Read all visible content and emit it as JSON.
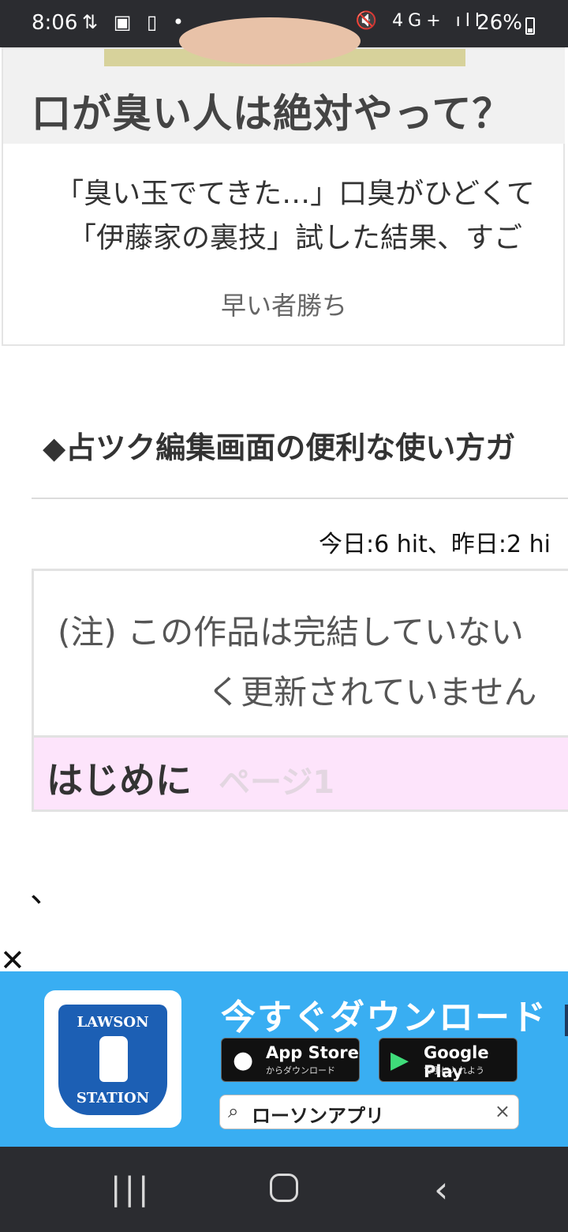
{
  "status_bar": {
    "time": "8:06",
    "left_icons": "⇅ ▣ ▯ •",
    "right_icons": "🔇 4G+ ıll",
    "battery": "26%"
  },
  "ad_card": {
    "headline": "口が臭い人は絶対やって？",
    "body_line1": "「臭い玉でてきた…」口臭がひどくて",
    "body_line2": "「伊藤家の裏技」試した結果、すご",
    "source": "早い者勝ち"
  },
  "article": {
    "title": "◆占ツク編集画面の便利な使い方ガ",
    "hits": "今日:6 hit、昨日:2 hi",
    "notice_line1": "(注) この作品は完結していない",
    "notice_line2": "く更新されていません",
    "section_heading": "はじめに",
    "section_page": "ページ1",
    "body_text": "、"
  },
  "banner": {
    "close": "✕",
    "logo_top": "LAWSON",
    "logo_bottom": "STATION",
    "title": "今すぐダウンロード",
    "app_store_name": "App Store",
    "app_store_sub": "からダウンロード",
    "google_play_name": "Google Play",
    "google_play_sub": "で手に入れよう",
    "search_text": "ローソンアプリ",
    "search_clear": "×",
    "accent_color": "#39aef2"
  },
  "nav_bar": {
    "recents": "|||",
    "back": "‹"
  }
}
